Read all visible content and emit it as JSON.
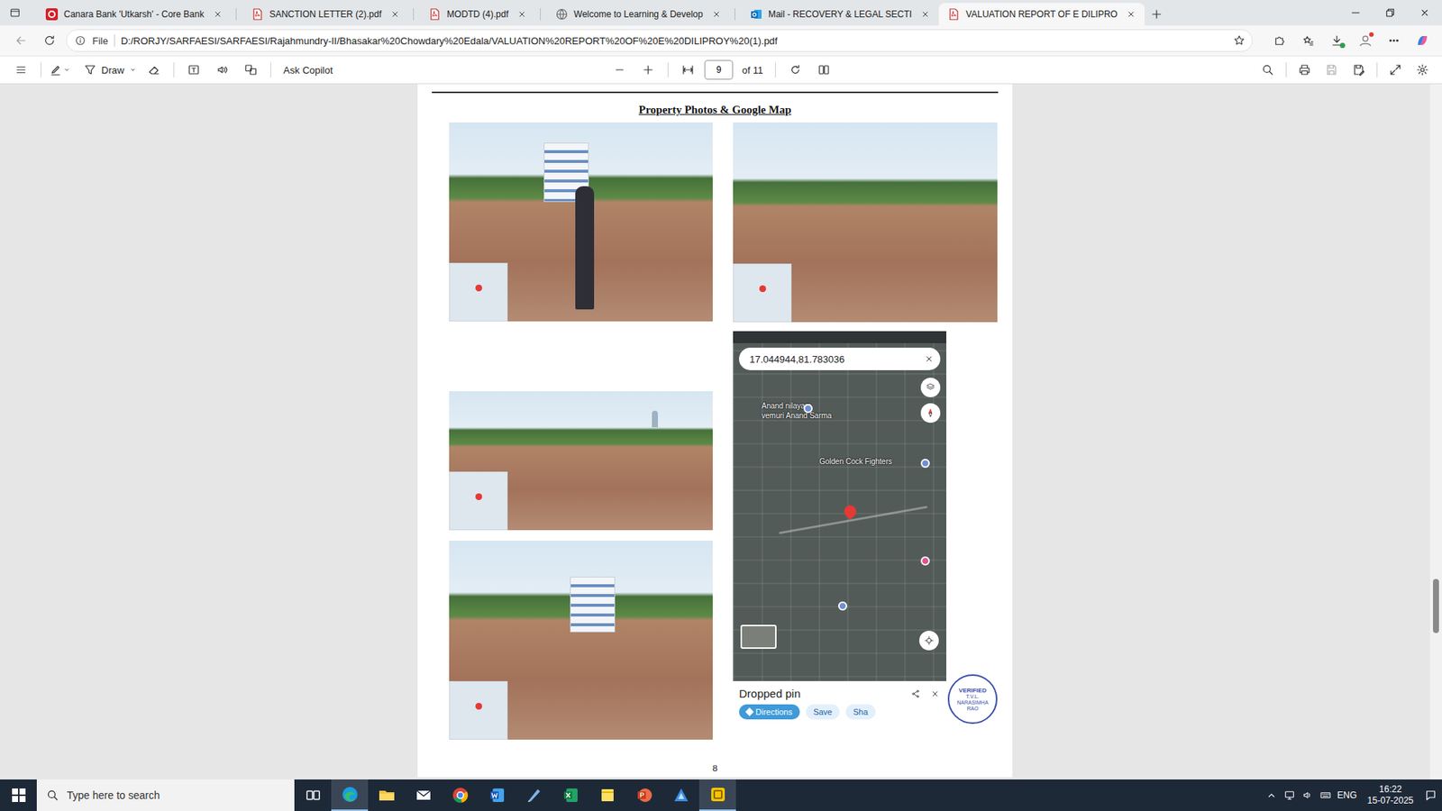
{
  "browser": {
    "tabs": [
      {
        "label": "Canara Bank 'Utkarsh' - Core Bank",
        "selected": false,
        "kind": "canara"
      },
      {
        "label": "SANCTION LETTER (2).pdf",
        "selected": false,
        "kind": "pdf"
      },
      {
        "label": "MODTD (4).pdf",
        "selected": false,
        "kind": "pdf"
      },
      {
        "label": "Welcome to Learning & Develop",
        "selected": false,
        "kind": "globe"
      },
      {
        "label": "Mail - RECOVERY & LEGAL SECTI",
        "selected": false,
        "kind": "outlook"
      },
      {
        "label": "VALUATION REPORT OF E DILIPRO",
        "selected": true,
        "kind": "pdf"
      }
    ],
    "address": {
      "scheme": "File",
      "url": "D:/RORJY/SARFAESI/SARFAESI/Rajahmundry-II/Bhasakar%20Chowdary%20Edala/VALUATION%20REPORT%20OF%20E%20DILIPROY%20(1).pdf"
    }
  },
  "pdf_toolbar": {
    "draw": "Draw",
    "copilot": "Ask Copilot",
    "page": "9",
    "page_count": "of 11"
  },
  "document": {
    "heading": "Property  Photos & Google Map",
    "photos": [
      {
        "kind": "building-person"
      },
      {
        "kind": "field"
      },
      {
        "kind": "field-tower"
      },
      {
        "kind": "building"
      }
    ],
    "map": {
      "coords": "17.044944,81.783036",
      "labels": [
        "Anand nilayam",
        "vemuri Anand Sarma",
        "Golden Cock Fighters"
      ],
      "panel_title": "Dropped pin",
      "actions": [
        "Directions",
        "Save",
        "Sha"
      ]
    },
    "stamp": {
      "top": "VERIFIED",
      "bottom": "T.V.L. NARASIMHA RAO"
    },
    "page_number": "8"
  },
  "taskbar": {
    "search_placeholder": "Type here to search",
    "apps": [
      {
        "kind": "taskview",
        "active": false
      },
      {
        "kind": "edge",
        "active": true
      },
      {
        "kind": "explorer",
        "active": false
      },
      {
        "kind": "mail",
        "active": false
      },
      {
        "kind": "chrome",
        "active": false
      },
      {
        "kind": "word",
        "active": false
      },
      {
        "kind": "notepad",
        "active": false
      },
      {
        "kind": "excel",
        "active": false
      },
      {
        "kind": "sticky",
        "active": false
      },
      {
        "kind": "powerpoint",
        "active": false
      },
      {
        "kind": "vpn",
        "active": false
      },
      {
        "kind": "yellow-app",
        "active": true
      }
    ],
    "language": "ENG",
    "time": "16:22",
    "date": "15-07-2025"
  }
}
